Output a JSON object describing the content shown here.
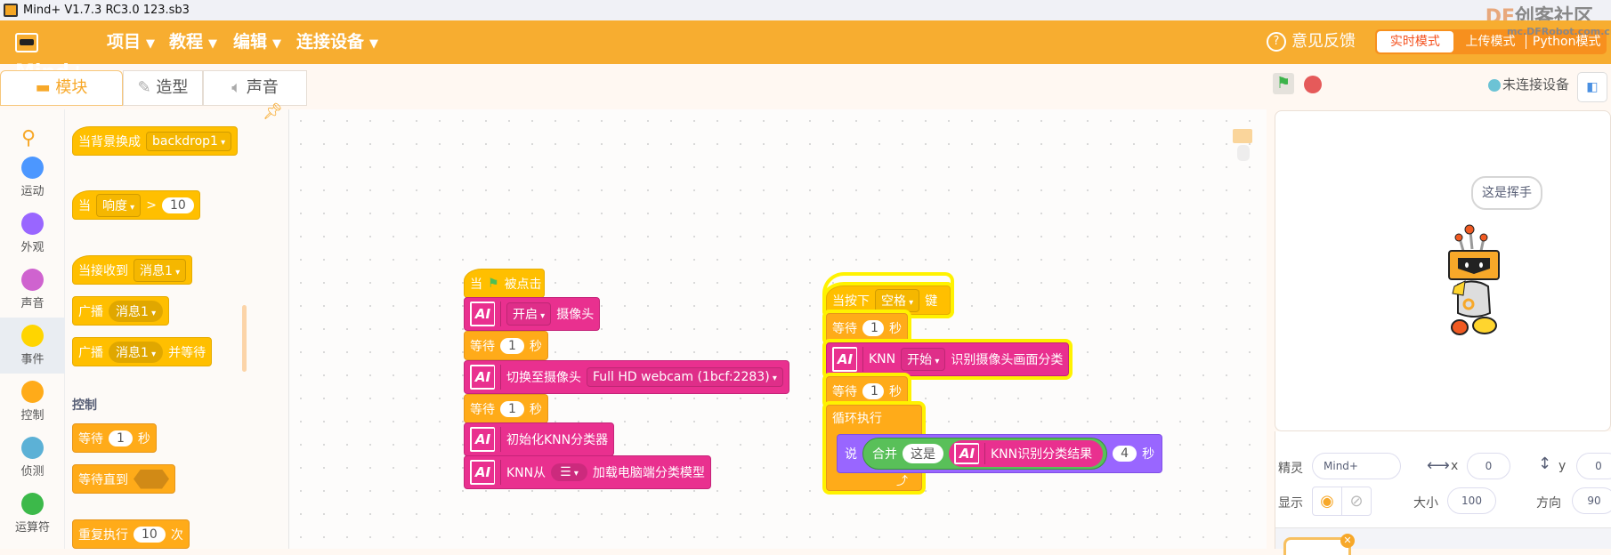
{
  "window": {
    "title": "Mind+ V1.7.3 RC3.0   123.sb3"
  },
  "watermark": {
    "brand": "DF创客社区",
    "brand_df": "DF",
    "brand_rest": "创客社区",
    "url": "mc.DFRobot.com.cn"
  },
  "menubar": {
    "logo": "Mind+",
    "items": [
      "项目",
      "教程",
      "编辑",
      "连接设备"
    ],
    "feedback": "意见反馈",
    "modes": [
      "实时模式",
      "上传模式",
      "Python模式"
    ],
    "active_mode": "实时模式",
    "color": "#F7AD30"
  },
  "tabs": [
    {
      "label": "模块",
      "icon": "blocks-icon",
      "selected": true
    },
    {
      "label": "造型",
      "icon": "brush-icon"
    },
    {
      "label": "声音",
      "icon": "speaker-icon"
    }
  ],
  "stage_controls": {
    "connection": "未连接设备"
  },
  "categories": [
    {
      "label": "运动",
      "color": "#4C97FF"
    },
    {
      "label": "外观",
      "color": "#9966FF"
    },
    {
      "label": "声音",
      "color": "#CF63CF"
    },
    {
      "label": "事件",
      "color": "#FFD500",
      "selected": true
    },
    {
      "label": "控制",
      "color": "#FFAB19"
    },
    {
      "label": "侦测",
      "color": "#5CB1D6"
    },
    {
      "label": "运算符",
      "color": "#3CB94A"
    }
  ],
  "palette": {
    "b1": {
      "text": "当背景换成",
      "dd": "backdrop1"
    },
    "b2": {
      "text": "当",
      "dd": "响度",
      "op": ">",
      "val": "10"
    },
    "b3": {
      "text": "当接收到",
      "dd": "消息1"
    },
    "b4": {
      "text": "广播",
      "dd": "消息1"
    },
    "b5": {
      "text": "广播",
      "dd": "消息1",
      "suffix": "并等待"
    },
    "section": "控制",
    "b6": {
      "text": "等待",
      "val": "1",
      "suffix": "秒"
    },
    "b7": {
      "text": "等待直到"
    },
    "b8": {
      "text": "重复执行",
      "val": "10",
      "suffix": "次"
    }
  },
  "script1": {
    "hat": {
      "pre": "当",
      "post": "被点击"
    },
    "s1": {
      "dd": "开启",
      "post": "摄像头"
    },
    "s2": {
      "pre": "等待",
      "val": "1",
      "post": "秒"
    },
    "s3": {
      "pre": "切换至摄像头",
      "dd": "Full HD webcam (1bcf:2283)"
    },
    "s4": {
      "pre": "等待",
      "val": "1",
      "post": "秒"
    },
    "s5": {
      "pre": "初始化KNN分类器"
    },
    "s6": {
      "pre": "KNN从",
      "post": "加载电脑端分类模型"
    }
  },
  "script2": {
    "hat": {
      "pre": "当按下",
      "dd": "空格",
      "post": "键"
    },
    "s1": {
      "pre": "等待",
      "val": "1",
      "post": "秒"
    },
    "s2": {
      "pre": "KNN",
      "dd": "开始",
      "post": "识别摄像头画面分类"
    },
    "s3": {
      "pre": "等待",
      "val": "1",
      "post": "秒"
    },
    "loop": "循环执行",
    "say": {
      "pre": "说",
      "join": "合并",
      "str": "这是",
      "reporter": "KNN识别分类结果",
      "val": "4",
      "post": "秒"
    }
  },
  "stage": {
    "speech": "这是挥手"
  },
  "sprite_info": {
    "sprite_label": "精灵",
    "sprite_name": "Mind+",
    "x_label": "x",
    "x": "0",
    "y_label": "y",
    "y": "0",
    "show_label": "显示",
    "size_label": "大小",
    "size": "100",
    "direction_label": "方向",
    "direction": "90"
  }
}
